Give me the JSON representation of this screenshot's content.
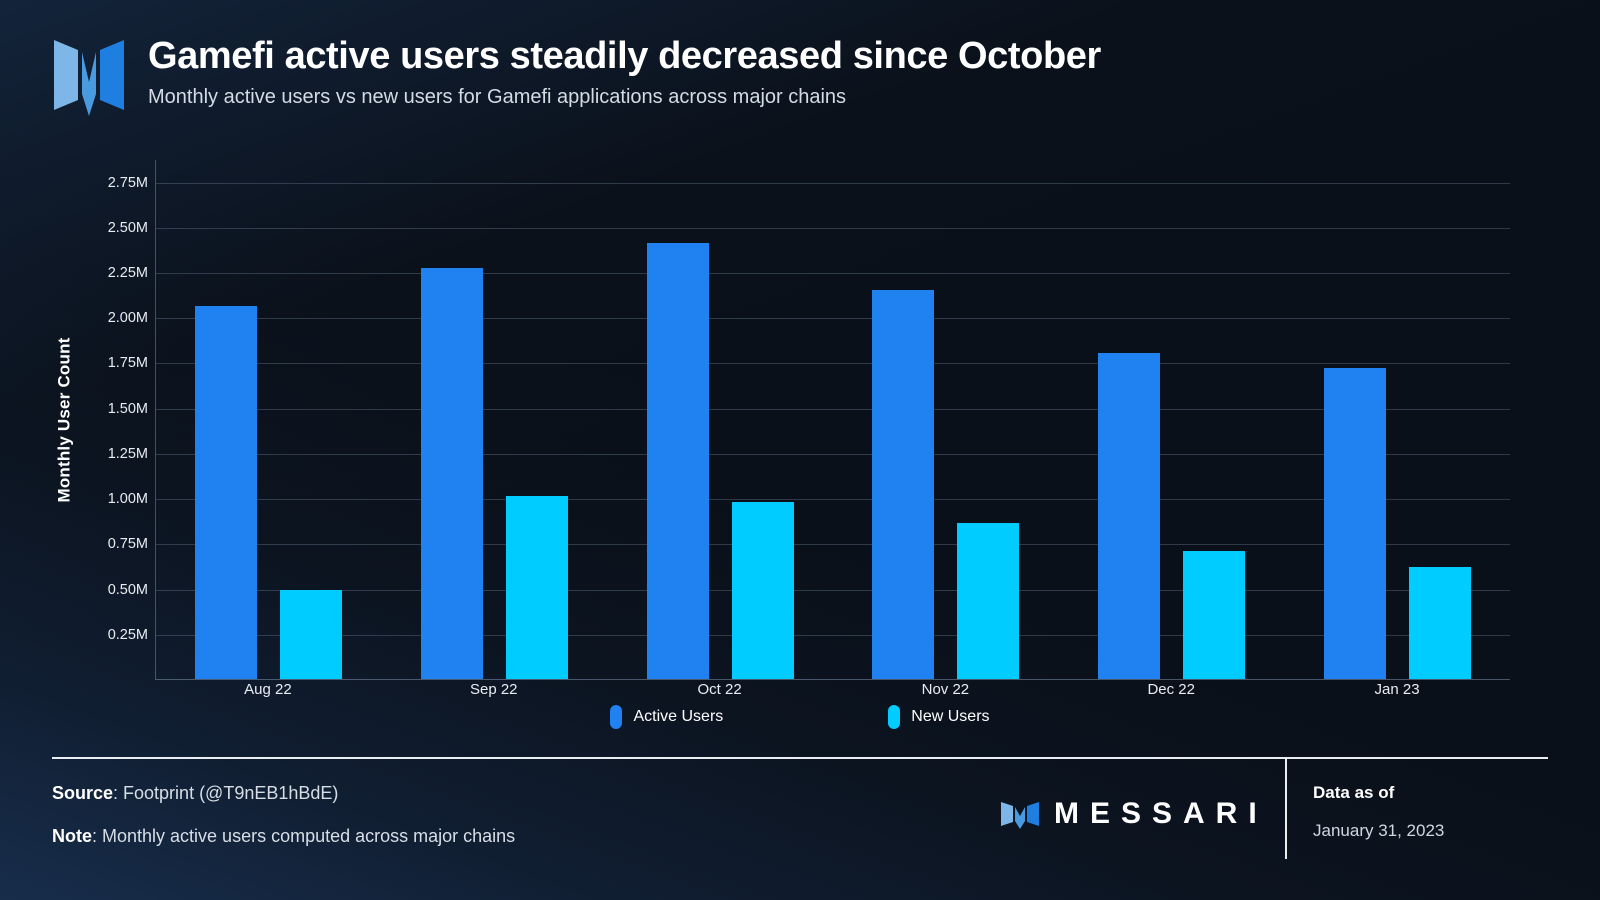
{
  "header": {
    "logo_icon": "messari-m-logo",
    "title": "Gamefi active users steadily decreased since October",
    "subtitle": "Monthly active users vs new users for Gamefi applications across major chains"
  },
  "legend": {
    "items": [
      {
        "label": "Active Users",
        "color": "#2081f0"
      },
      {
        "label": "New Users",
        "color": "#00ccff"
      }
    ]
  },
  "footer": {
    "source_label": "Source",
    "source_value": ": Footprint (@T9nEB1hBdE)",
    "note_label": "Note",
    "note_value": ": Monthly active users computed across major chains",
    "brand_icon": "messari-m-logo",
    "brand_word": "MESSARI",
    "data_as_of_label": "Data as of",
    "data_as_of_date": "January 31, 2023"
  },
  "chart_data": {
    "type": "bar",
    "title": "Gamefi active users steadily decreased since October",
    "subtitle": "Monthly active users vs new users for Gamefi applications across major chains",
    "xlabel": "",
    "ylabel": "Monthly User Count",
    "ylim": [
      0,
      2.875
    ],
    "yunit": "M",
    "grid": true,
    "legend_position": "bottom-center",
    "categories": [
      "Aug 22",
      "Sep 22",
      "Oct 22",
      "Nov 22",
      "Dec 22",
      "Jan 23"
    ],
    "ytick_labels": [
      "0.25M",
      "0.50M",
      "0.75M",
      "1.00M",
      "1.25M",
      "1.50M",
      "1.75M",
      "2.00M",
      "2.25M",
      "2.50M",
      "2.75M"
    ],
    "ytick_values": [
      0.25,
      0.5,
      0.75,
      1.0,
      1.25,
      1.5,
      1.75,
      2.0,
      2.25,
      2.5,
      2.75
    ],
    "series": [
      {
        "name": "Active Users",
        "color": "#2081f0",
        "values": [
          2.06,
          2.27,
          2.41,
          2.15,
          1.8,
          1.72
        ]
      },
      {
        "name": "New Users",
        "color": "#00ccff",
        "values": [
          0.49,
          1.01,
          0.98,
          0.86,
          0.71,
          0.62
        ]
      }
    ]
  }
}
